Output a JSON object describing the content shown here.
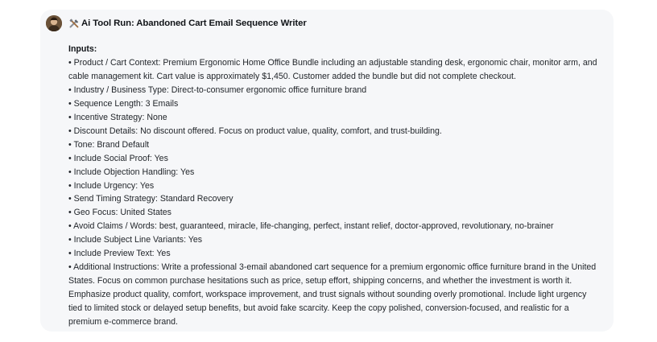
{
  "header": {
    "tool_emoji": "🛠️",
    "title": "Ai Tool Run: Abandoned Cart Email Sequence Writer"
  },
  "inputs": {
    "heading": "Inputs:",
    "bullet": "•",
    "items": [
      "Product / Cart Context: Premium Ergonomic Home Office Bundle including an adjustable standing desk, ergonomic chair, monitor arm, and cable management kit. Cart value is approximately $1,450. Customer added the bundle but did not complete checkout.",
      "Industry / Business Type: Direct-to-consumer ergonomic office furniture brand",
      "Sequence Length: 3 Emails",
      "Incentive Strategy: None",
      "Discount Details: No discount offered. Focus on product value, quality, comfort, and trust-building.",
      "Tone: Brand Default",
      "Include Social Proof: Yes",
      "Include Objection Handling: Yes",
      "Include Urgency: Yes",
      "Send Timing Strategy: Standard Recovery",
      "Geo Focus: United States",
      "Avoid Claims / Words: best, guaranteed, miracle, life-changing, perfect, instant relief, doctor-approved, revolutionary, no-brainer",
      "Include Subject Line Variants: Yes",
      "Include Preview Text: Yes",
      "Additional Instructions: Write a professional 3-email abandoned cart sequence for a premium ergonomic office furniture brand in the United States. Focus on common purchase hesitations such as price, setup effort, shipping concerns, and whether the investment is worth it. Emphasize product quality, comfort, workspace improvement, and trust signals without sounding overly promotional. Include light urgency tied to limited stock or delayed setup benefits, but avoid fake scarcity. Keep the copy polished, conversion-focused, and realistic for a premium e-commerce brand."
    ]
  }
}
